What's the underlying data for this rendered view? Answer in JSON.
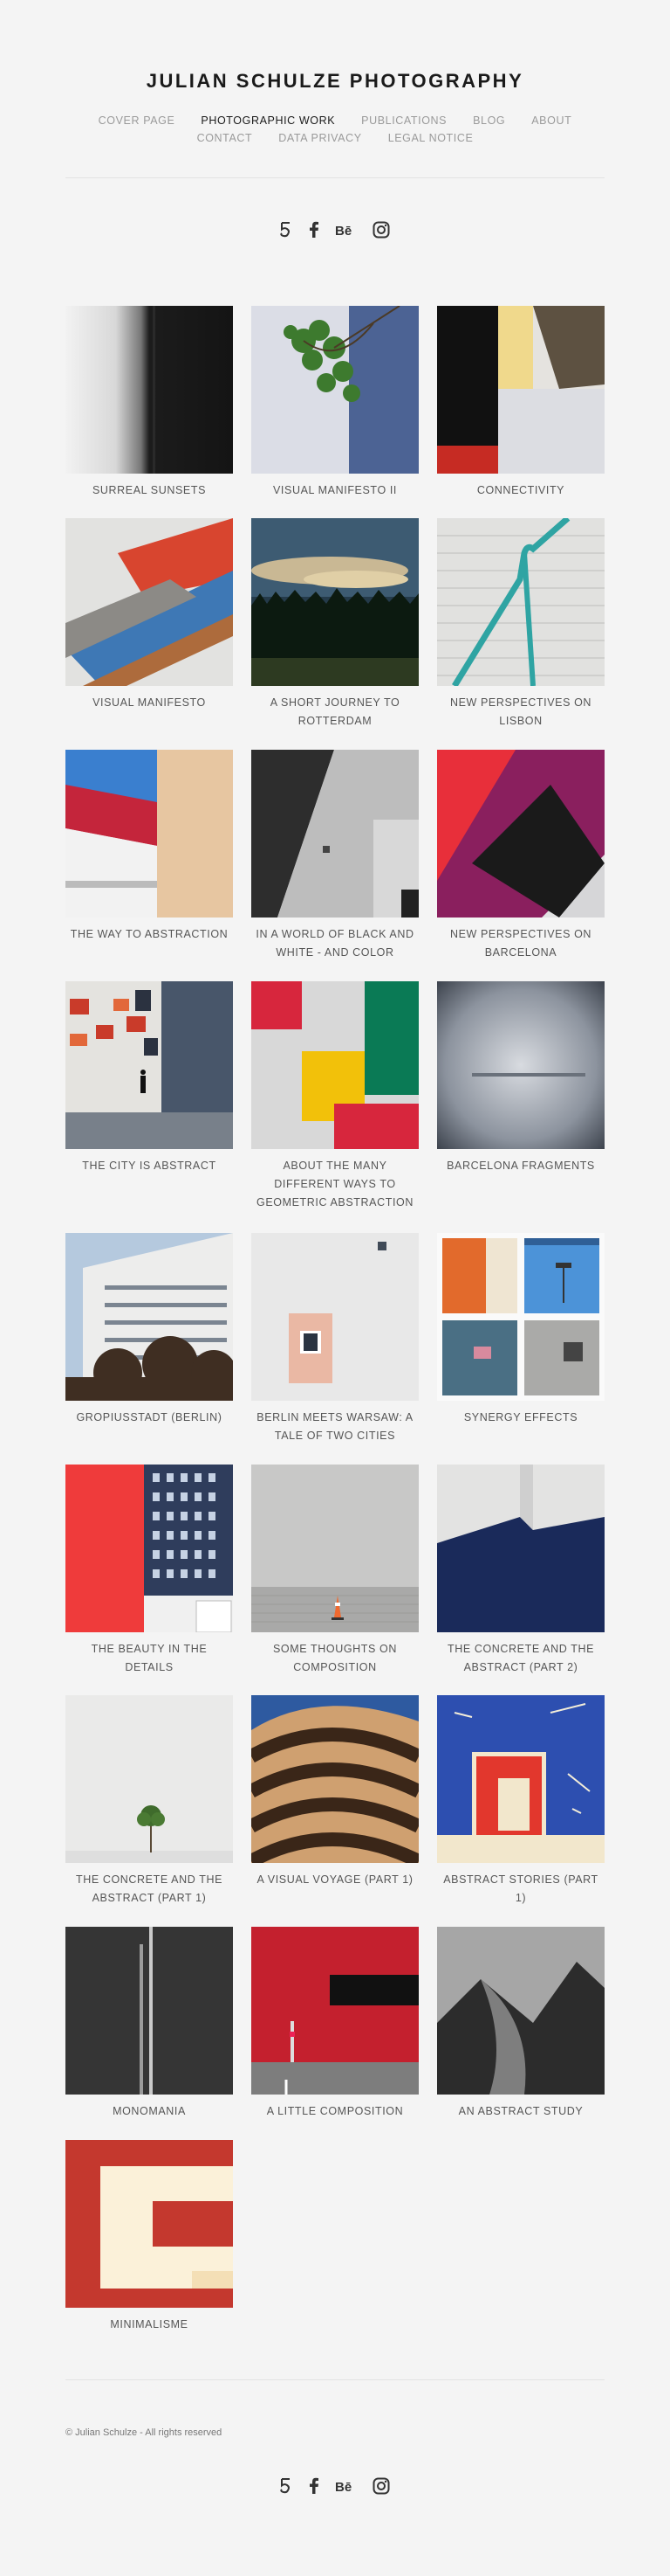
{
  "site": {
    "title": "JULIAN SCHULZE PHOTOGRAPHY"
  },
  "nav": {
    "row1": [
      {
        "label": "COVER PAGE",
        "active": false
      },
      {
        "label": "PHOTOGRAPHIC WORK",
        "active": true
      },
      {
        "label": "PUBLICATIONS",
        "active": false
      },
      {
        "label": "BLOG",
        "active": false
      },
      {
        "label": "ABOUT",
        "active": false
      }
    ],
    "row2": [
      {
        "label": "CONTACT",
        "active": false
      },
      {
        "label": "DATA PRIVACY",
        "active": false
      },
      {
        "label": "LEGAL NOTICE",
        "active": false
      }
    ]
  },
  "social": [
    "500px-icon",
    "facebook-icon",
    "behance-icon",
    "instagram-icon"
  ],
  "gallery": [
    {
      "caption": "SURREAL SUNSETS",
      "art": "surreal"
    },
    {
      "caption": "VISUAL MANIFESTO II",
      "art": "manifesto2"
    },
    {
      "caption": "CONNECTIVITY",
      "art": "connectivity"
    },
    {
      "caption": "VISUAL MANIFESTO",
      "art": "manifesto"
    },
    {
      "caption": "A SHORT JOURNEY TO ROTTERDAM",
      "art": "rotterdam"
    },
    {
      "caption": "NEW PERSPECTIVES ON LISBON",
      "art": "lisbon"
    },
    {
      "caption": "THE WAY TO ABSTRACTION",
      "art": "way"
    },
    {
      "caption": "IN A WORLD OF BLACK AND WHITE - AND COLOR",
      "art": "blackwhite"
    },
    {
      "caption": "NEW PERSPECTIVES ON BARCELONA",
      "art": "barcelona"
    },
    {
      "caption": "THE CITY IS ABSTRACT",
      "art": "city"
    },
    {
      "caption": "ABOUT THE MANY DIFFERENT WAYS TO GEOMETRIC ABSTRACTION",
      "art": "geometric"
    },
    {
      "caption": "BARCELONA FRAGMENTS",
      "art": "fragments"
    },
    {
      "caption": "GROPIUSSTADT (BERLIN)",
      "art": "gropius"
    },
    {
      "caption": "BERLIN MEETS WARSAW: A TALE OF TWO CITIES",
      "art": "berlin"
    },
    {
      "caption": "SYNERGY EFFECTS",
      "art": "synergy"
    },
    {
      "caption": "THE BEAUTY IN THE DETAILS",
      "art": "beauty"
    },
    {
      "caption": "SOME THOUGHTS ON COMPOSITION",
      "art": "composition"
    },
    {
      "caption": "THE CONCRETE AND THE ABSTRACT (PART 2)",
      "art": "concrete2"
    },
    {
      "caption": "THE CONCRETE AND THE ABSTRACT (PART 1)",
      "art": "concrete1"
    },
    {
      "caption": "A VISUAL VOYAGE (PART 1)",
      "art": "voyage"
    },
    {
      "caption": "ABSTRACT STORIES (PART 1)",
      "art": "stories"
    },
    {
      "caption": "MONOMANIA",
      "art": "monomania"
    },
    {
      "caption": "A LITTLE COMPOSITION",
      "art": "little"
    },
    {
      "caption": "AN ABSTRACT STUDY",
      "art": "study"
    },
    {
      "caption": "MINIMALISME",
      "art": "minimalisme"
    }
  ],
  "footer": {
    "copyright": "© Julian Schulze - All rights reserved"
  }
}
